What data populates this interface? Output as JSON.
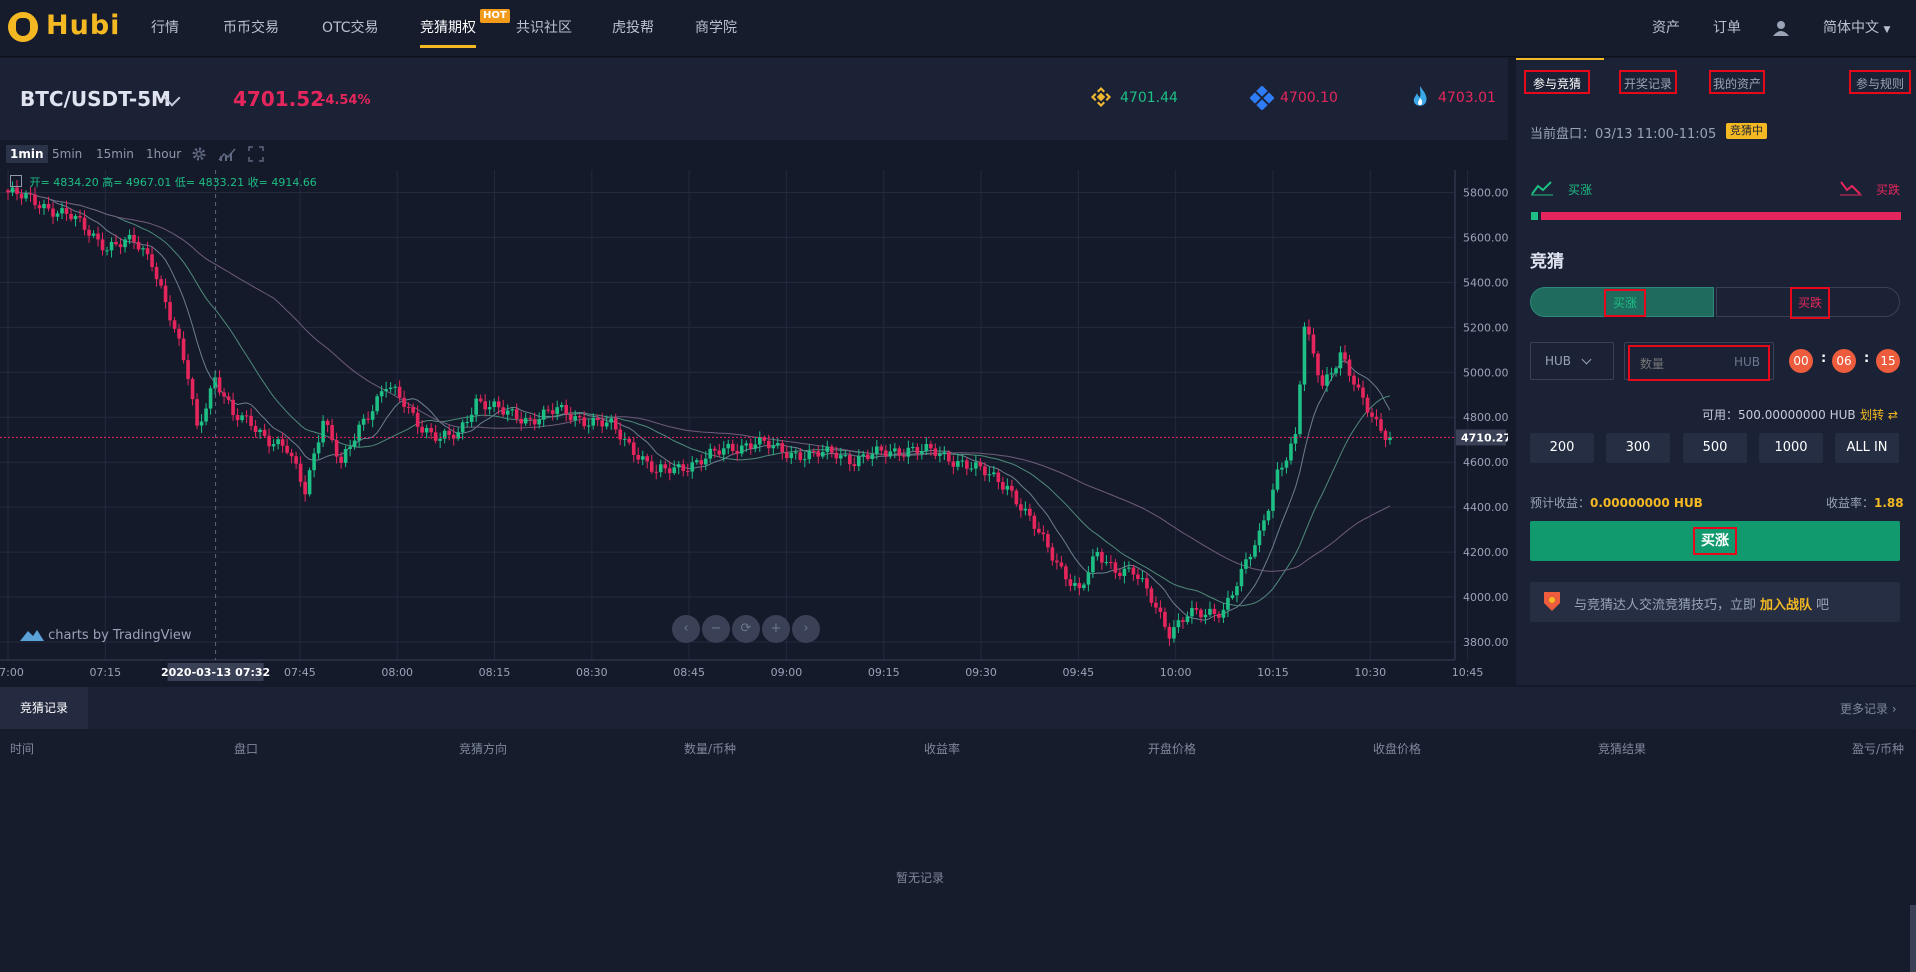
{
  "brand": {
    "name": "Hubi"
  },
  "nav": {
    "items": [
      "行情",
      "币币交易",
      "OTC交易",
      "竞猜期权",
      "共识社区",
      "虎投帮",
      "商学院"
    ],
    "hot_badge": "HOT",
    "right": {
      "assets": "资产",
      "orders": "订单",
      "language": "简体中文"
    }
  },
  "header": {
    "pair": "BTC/USDT-5M",
    "price": "4701.52",
    "change": "-4.54%",
    "exchanges": [
      {
        "icon": "binance-icon",
        "price": "4701.44",
        "color": "#1dbf85"
      },
      {
        "icon": "diamond-exchange-icon",
        "price": "4700.10",
        "color": "#e5265c"
      },
      {
        "icon": "flame-exchange-icon",
        "price": "4703.01",
        "color": "#e5265c"
      }
    ]
  },
  "toolbar": {
    "timeframes": [
      "1min",
      "5min",
      "15min",
      "1hour"
    ],
    "active": "1min"
  },
  "chart_data": {
    "type": "candlestick",
    "ohlc_label": {
      "open": "开= 4834.20",
      "high": "高= 4967.01",
      "low": "低= 4833.21",
      "close": "收= 4914.66"
    },
    "y_ticks": [
      "5800.00",
      "5600.00",
      "5400.00",
      "5200.00",
      "5000.00",
      "4800.00",
      "4600.00",
      "4400.00",
      "4200.00",
      "4000.00",
      "3800.00"
    ],
    "ylim": [
      3720,
      5900
    ],
    "x_ticks": [
      "07:00",
      "07:15",
      "07:45",
      "08:00",
      "08:15",
      "08:30",
      "08:45",
      "09:00",
      "09:15",
      "09:30",
      "09:45",
      "10:00",
      "10:15",
      "10:30",
      "10:45"
    ],
    "x_hover_label": "2020-03-13 07:32",
    "last_price_label": "4710.27",
    "last_price": 4710.27,
    "closes_anchor": [
      [
        0,
        5800
      ],
      [
        6,
        5760
      ],
      [
        14,
        5690
      ],
      [
        22,
        5560
      ],
      [
        28,
        5580
      ],
      [
        32,
        5500
      ],
      [
        36,
        5250
      ],
      [
        40,
        4980
      ],
      [
        42,
        4750
      ],
      [
        46,
        4980
      ],
      [
        50,
        4800
      ],
      [
        54,
        4780
      ],
      [
        58,
        4700
      ],
      [
        62,
        4650
      ],
      [
        66,
        4480
      ],
      [
        70,
        4800
      ],
      [
        74,
        4580
      ],
      [
        78,
        4760
      ],
      [
        84,
        4940
      ],
      [
        88,
        4860
      ],
      [
        92,
        4760
      ],
      [
        96,
        4700
      ],
      [
        100,
        4720
      ],
      [
        104,
        4880
      ],
      [
        110,
        4820
      ],
      [
        116,
        4790
      ],
      [
        122,
        4830
      ],
      [
        128,
        4790
      ],
      [
        134,
        4760
      ],
      [
        140,
        4640
      ],
      [
        144,
        4550
      ],
      [
        148,
        4570
      ],
      [
        154,
        4610
      ],
      [
        160,
        4660
      ],
      [
        166,
        4690
      ],
      [
        172,
        4650
      ],
      [
        178,
        4630
      ],
      [
        184,
        4640
      ],
      [
        188,
        4610
      ],
      [
        194,
        4640
      ],
      [
        200,
        4660
      ],
      [
        206,
        4640
      ],
      [
        212,
        4600
      ],
      [
        218,
        4540
      ],
      [
        222,
        4500
      ],
      [
        226,
        4370
      ],
      [
        230,
        4250
      ],
      [
        234,
        4130
      ],
      [
        238,
        4020
      ],
      [
        242,
        4190
      ],
      [
        246,
        4130
      ],
      [
        250,
        4110
      ],
      [
        254,
        3990
      ],
      [
        258,
        3850
      ],
      [
        262,
        3920
      ],
      [
        266,
        3920
      ],
      [
        270,
        3950
      ],
      [
        274,
        4100
      ],
      [
        278,
        4270
      ],
      [
        282,
        4560
      ],
      [
        286,
        4700
      ],
      [
        288,
        5200
      ],
      [
        292,
        4950
      ],
      [
        296,
        5080
      ],
      [
        300,
        4900
      ],
      [
        304,
        4780
      ],
      [
        307,
        4710
      ]
    ],
    "ma_series": [
      "MA5",
      "MA10",
      "MA30"
    ],
    "watermark": "charts by TradingView",
    "grid": true
  },
  "panel": {
    "tabs": [
      "参与竞猜",
      "开奖记录",
      "我的资产",
      "参与规则"
    ],
    "current_round_label": "当前盘口：03/13 11:00-11:05",
    "status": "竞猜中",
    "rise_label": "买涨",
    "fall_label": "买跌",
    "rise_ratio": 0.02,
    "section_title": "竞猜",
    "toggle": {
      "rise": "买涨",
      "fall": "买跌"
    },
    "currency": "HUB",
    "amount_placeholder": "数量",
    "amount_unit": "HUB",
    "countdown": [
      "00",
      "06",
      "15"
    ],
    "available": "可用：500.00000000 HUB",
    "transfer": "划转",
    "amounts": [
      "200",
      "300",
      "500",
      "1000",
      "ALL IN"
    ],
    "expected_label": "预计收益：",
    "expected_value": "0.00000000 HUB",
    "rate_label": "收益率：",
    "rate_value": "1.88",
    "submit": "买涨",
    "banner_text": "与竞猜达人交流竞猜技巧，立即",
    "banner_link": "加入战队",
    "banner_suffix": "吧"
  },
  "records": {
    "tab": "竞猜记录",
    "more": "更多记录",
    "columns": [
      "时间",
      "盘口",
      "竞猜方向",
      "数量/币种",
      "收益率",
      "开盘价格",
      "收盘价格",
      "竞猜结果",
      "盈亏/币种"
    ],
    "empty": "暂无记录"
  }
}
